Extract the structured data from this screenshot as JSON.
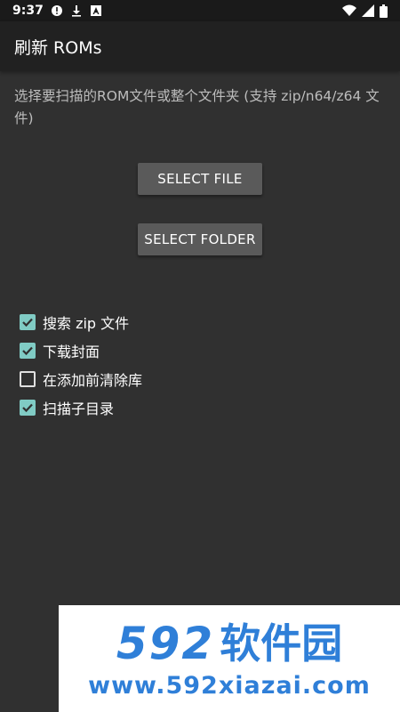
{
  "status_bar": {
    "time": "9:37",
    "icons_left": [
      "alert-icon",
      "download-icon",
      "text-icon"
    ],
    "icons_right": [
      "wifi-icon",
      "signal-icon",
      "battery-icon"
    ]
  },
  "app_bar": {
    "title": "刷新 ROMs"
  },
  "main": {
    "description": "选择要扫描的ROM文件或整个文件夹 (支持 zip/n64/z64 文件)",
    "select_file_label": "SELECT FILE",
    "select_folder_label": "SELECT FOLDER",
    "options": [
      {
        "label": "搜索 zip 文件",
        "checked": true
      },
      {
        "label": "下载封面",
        "checked": true
      },
      {
        "label": "在添加前清除库",
        "checked": false
      },
      {
        "label": "扫描子目录",
        "checked": true
      }
    ]
  },
  "watermark": {
    "logo_number": "592",
    "logo_text": "软件园",
    "url": "www.592xiazai.com"
  },
  "colors": {
    "accent": "#80cbc4",
    "background": "#303030",
    "app_bar": "#212121",
    "button": "#5a5a5a",
    "watermark_blue": "#2f7fd8"
  }
}
